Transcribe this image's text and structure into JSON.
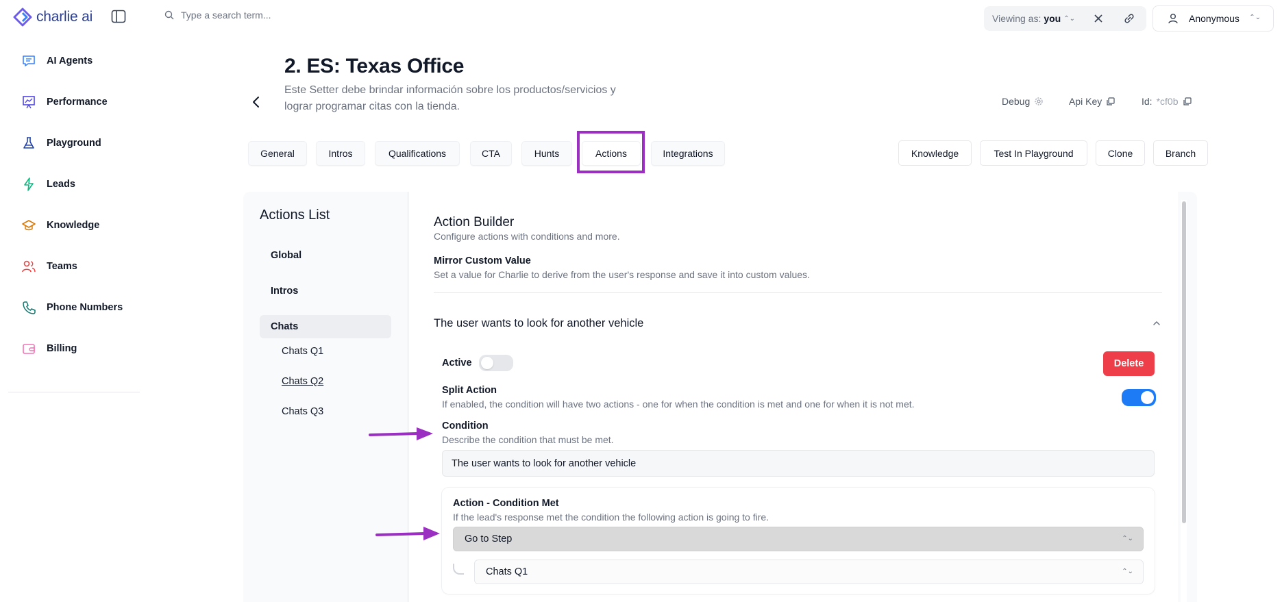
{
  "app": {
    "logo_text": "charlie ai",
    "brand_color": "#2c3e8c"
  },
  "sidebar": {
    "items": [
      {
        "label": "AI Agents",
        "icon": "chat-bubble-icon",
        "color": "#3b82f6"
      },
      {
        "label": "Performance",
        "icon": "chart-board-icon",
        "color": "#4f46e5"
      },
      {
        "label": "Playground",
        "icon": "flask-icon",
        "color": "#1e40af"
      },
      {
        "label": "Leads",
        "icon": "lightning-icon",
        "color": "#10b981"
      },
      {
        "label": "Knowledge",
        "icon": "graduation-cap-icon",
        "color": "#d97706"
      },
      {
        "label": "Teams",
        "icon": "users-icon",
        "color": "#ef4444"
      },
      {
        "label": "Phone Numbers",
        "icon": "phone-icon",
        "color": "#0f766e"
      },
      {
        "label": "Billing",
        "icon": "wallet-icon",
        "color": "#f472b6"
      }
    ]
  },
  "topbar": {
    "search_placeholder": "Type a search term...",
    "viewing_label": "Viewing as:",
    "viewing_value": "you",
    "user_name": "Anonymous"
  },
  "header": {
    "title": "2. ES: Texas Office",
    "description": "Este Setter debe brindar información sobre los productos/servicios y lograr programar citas con la tienda.",
    "debug_label": "Debug",
    "api_key_label": "Api Key",
    "id_label": "Id:",
    "id_value": "*cf0b"
  },
  "tabs": [
    {
      "label": "General"
    },
    {
      "label": "Intros"
    },
    {
      "label": "Qualifications"
    },
    {
      "label": "CTA"
    },
    {
      "label": "Hunts"
    },
    {
      "label": "Actions",
      "active": true
    },
    {
      "label": "Integrations"
    }
  ],
  "header_buttons": [
    {
      "label": "Knowledge"
    },
    {
      "label": "Test In Playground"
    },
    {
      "label": "Clone"
    },
    {
      "label": "Branch"
    }
  ],
  "actions_list": {
    "title": "Actions List",
    "groups": [
      {
        "label": "Global"
      },
      {
        "label": "Intros"
      },
      {
        "label": "Chats",
        "selected": true,
        "children": [
          "Chats Q1",
          "Chats Q2",
          "Chats Q3"
        ]
      }
    ]
  },
  "builder": {
    "title": "Action Builder",
    "subtitle": "Configure actions with conditions and more.",
    "mirror_title": "Mirror Custom Value",
    "mirror_subtitle": "Set a value for Charlie to derive from the user's response and save it into custom values.",
    "action_title": "The user wants to look for another vehicle",
    "active_label": "Active",
    "active_on": false,
    "delete_label": "Delete",
    "delete_color": "#ee3e4a",
    "split_title": "Split Action",
    "split_subtitle": "If enabled, the condition will have two actions - one for when the condition is met and one for when it is not met.",
    "split_on": true,
    "toggle_on_color": "#1d7bf5",
    "condition_title": "Condition",
    "condition_subtitle": "Describe the condition that must be met.",
    "condition_value": "The user wants to look for another vehicle",
    "met_title": "Action - Condition Met",
    "met_subtitle": "If the lead's response met the condition the following action is going to fire.",
    "met_action": "Go to Step",
    "met_step": "Chats Q1"
  },
  "annotation_color": "#9a2fc1"
}
